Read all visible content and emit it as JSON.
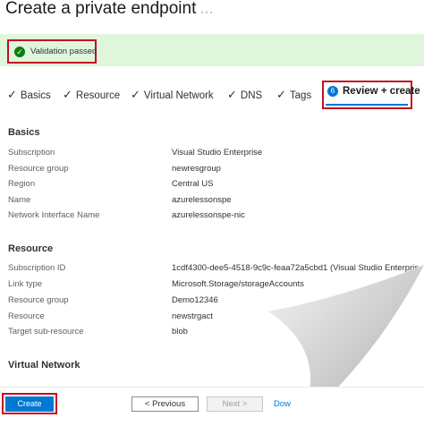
{
  "header": {
    "title": "Create a private endpoint",
    "more": "···"
  },
  "validation": {
    "text": "Validation passed"
  },
  "tabs": [
    {
      "label": "Basics"
    },
    {
      "label": "Resource"
    },
    {
      "label": "Virtual Network"
    },
    {
      "label": "DNS"
    },
    {
      "label": "Tags"
    }
  ],
  "active_tab": {
    "number": "6",
    "label": "Review + create"
  },
  "sections": {
    "basics": {
      "title": "Basics",
      "rows": [
        {
          "label": "Subscription",
          "value": "Visual Studio Enterprise"
        },
        {
          "label": "Resource group",
          "value": "newresgroup"
        },
        {
          "label": "Region",
          "value": "Central US"
        },
        {
          "label": "Name",
          "value": "azurelessonspe"
        },
        {
          "label": "Network Interface Name",
          "value": "azurelessonspe-nic"
        }
      ]
    },
    "resource": {
      "title": "Resource",
      "rows": [
        {
          "label": "Subscription ID",
          "value": "1cdf4300-dee5-4518-9c9c-feaa72a5cbd1 (Visual Studio Enterpris"
        },
        {
          "label": "Link type",
          "value": "Microsoft.Storage/storageAccounts"
        },
        {
          "label": "Resource group",
          "value": "Demo12346"
        },
        {
          "label": "Resource",
          "value": "newstrgact"
        },
        {
          "label": "Target sub-resource",
          "value": "blob"
        }
      ]
    },
    "virtual_network": {
      "title": "Virtual Network"
    }
  },
  "footer": {
    "create": "Create",
    "previous": "< Previous",
    "next": "Next >",
    "download": "Dow"
  },
  "colors": {
    "accent": "#0078d4",
    "success_bg": "#dff6dd",
    "success_icon": "#107c10",
    "highlight_box": "#c50f1f"
  }
}
